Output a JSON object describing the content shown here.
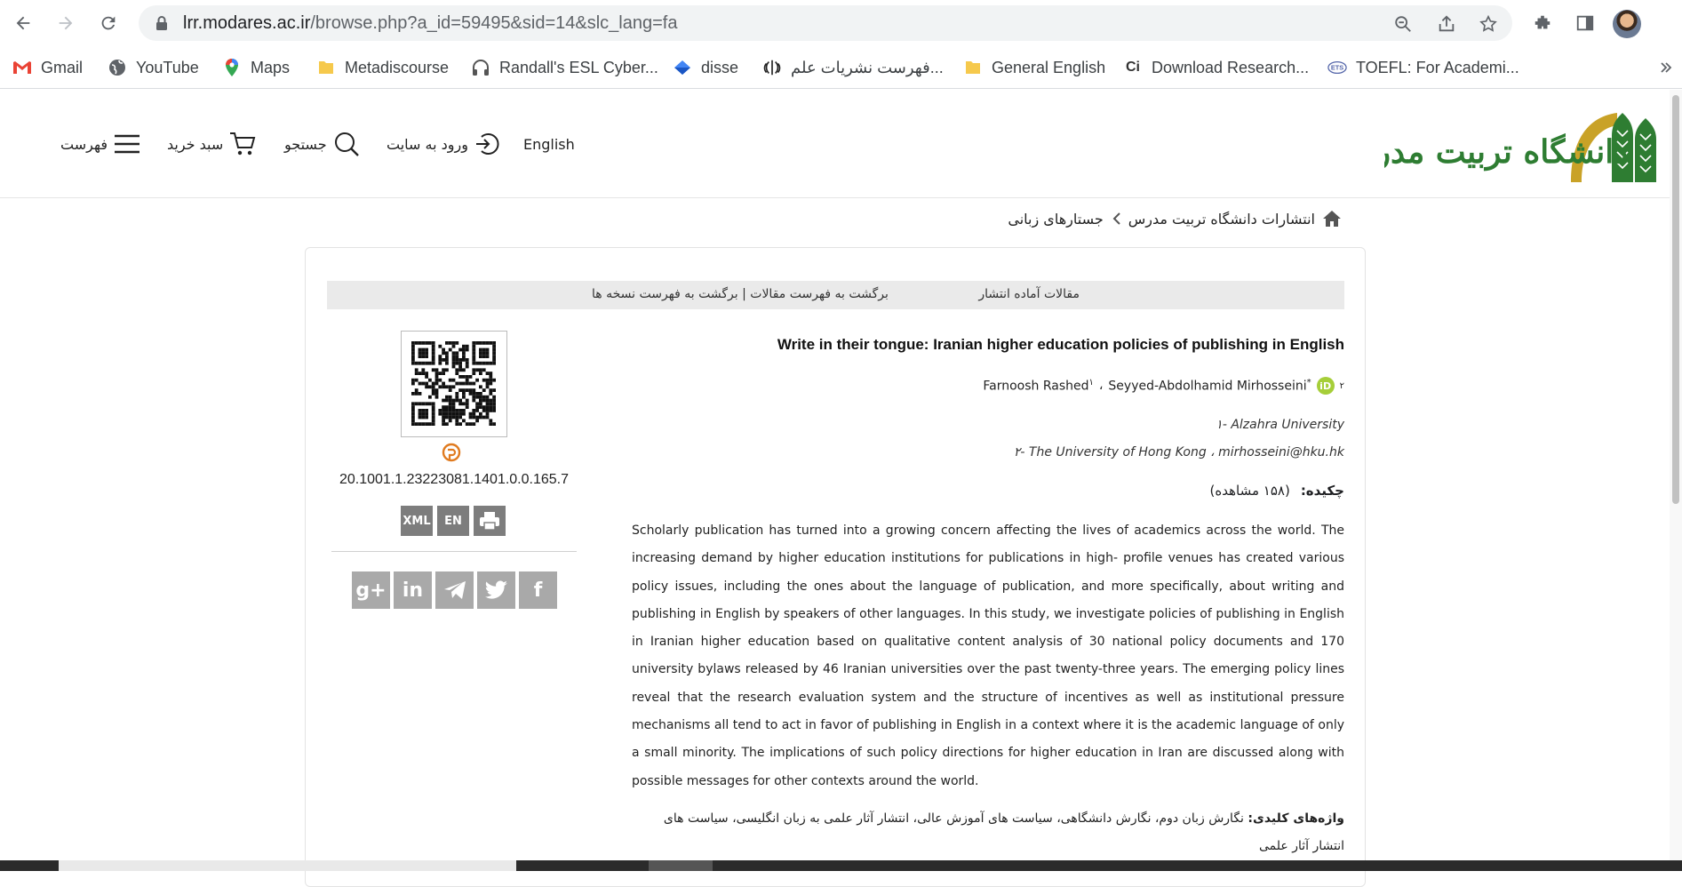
{
  "browser": {
    "url_host": "lrr.modares.ac.ir",
    "url_rest": "/browse.php?a_id=59495&sid=14&slc_lang=fa",
    "bookmarks": [
      "Gmail",
      "YouTube",
      "Maps",
      "Metadiscourse",
      "Randall's ESL Cyber...",
      "disse",
      "فهرست نشریات علم...",
      "General English",
      "Download Research...",
      "TOEFL: For Academi..."
    ],
    "colors": {
      "gmail": "#ea4335",
      "folder": "#f6c94c",
      "disse": "#4285f4"
    }
  },
  "header": {
    "menu_label": "فهرست",
    "cart_label": "سبد خرید",
    "search_label": "جستجو",
    "login_label": "ورود به سایت",
    "lang_label": "English",
    "logo_text": "دانشگاه تربیت مدرس"
  },
  "breadcrumb": {
    "home": "انتشارات دانشگاه تربیت مدرس",
    "current": "جستارهای زبانی"
  },
  "nav": {
    "ready_articles": "مقالات آماده انتشار",
    "back_links": "برگشت به فهرست مقالات | برگشت به فهرست نسخه ها"
  },
  "article": {
    "title": "Write in their tongue: Iranian higher education policies of publishing in English",
    "author1": "Farnoosh Rashed",
    "author1_sup": "۱",
    "sep": "،",
    "author2": "Seyyed-Abdolhamid Mirhosseini",
    "author2_sup": "*",
    "author2_num": "۲",
    "orcid": "iD",
    "aff1": "۱- Alzahra University",
    "aff2": "۲- The University of Hong Kong ، mirhosseini@hku.hk",
    "abstract_label": "چکیده:",
    "views": "(۱۵۸ مشاهده)",
    "abstract": "Scholarly publication has turned into a growing concern affecting the lives of academics across the world. The increasing demand by higher education institutions for publications in high- profile venues has created various policy issues, including the ones about the language of publication, and more specifically, about writing and publishing in English by speakers of other languages. In this study, we investigate policies of publishing in English in Iranian higher education based on qualitative content analysis of 30 national policy documents and 170 university bylaws released by 46 Iranian universities over the past twenty-three years. The emerging policy lines reveal that the research evaluation system and the structure of incentives as well as institutional pressure mechanisms all tend to act in favor of publishing in English in a context where it is the academic language of only a small minority. The implications of such policy directions for higher education in Iran are discussed along with possible messages for other contexts around the world.",
    "keywords_label": "واژه‌های کلیدی:",
    "keywords": "نگارش زبان دوم، نگارش دانشگاهی، سیاست های آموزش عالی، انتشار آثار علمی به زبان انگلیسی، سیاست های انتشار آثار علمی"
  },
  "sidebar": {
    "doi": "20.1001.1.23223081.1401.0.0.165.7",
    "formats": [
      "XML",
      "EN"
    ],
    "share_icons": [
      "google-plus-icon",
      "linkedin-icon",
      "telegram-icon",
      "twitter-icon",
      "facebook-icon"
    ],
    "share_glyphs": [
      "g+",
      "in",
      "",
      "",
      "f"
    ]
  }
}
